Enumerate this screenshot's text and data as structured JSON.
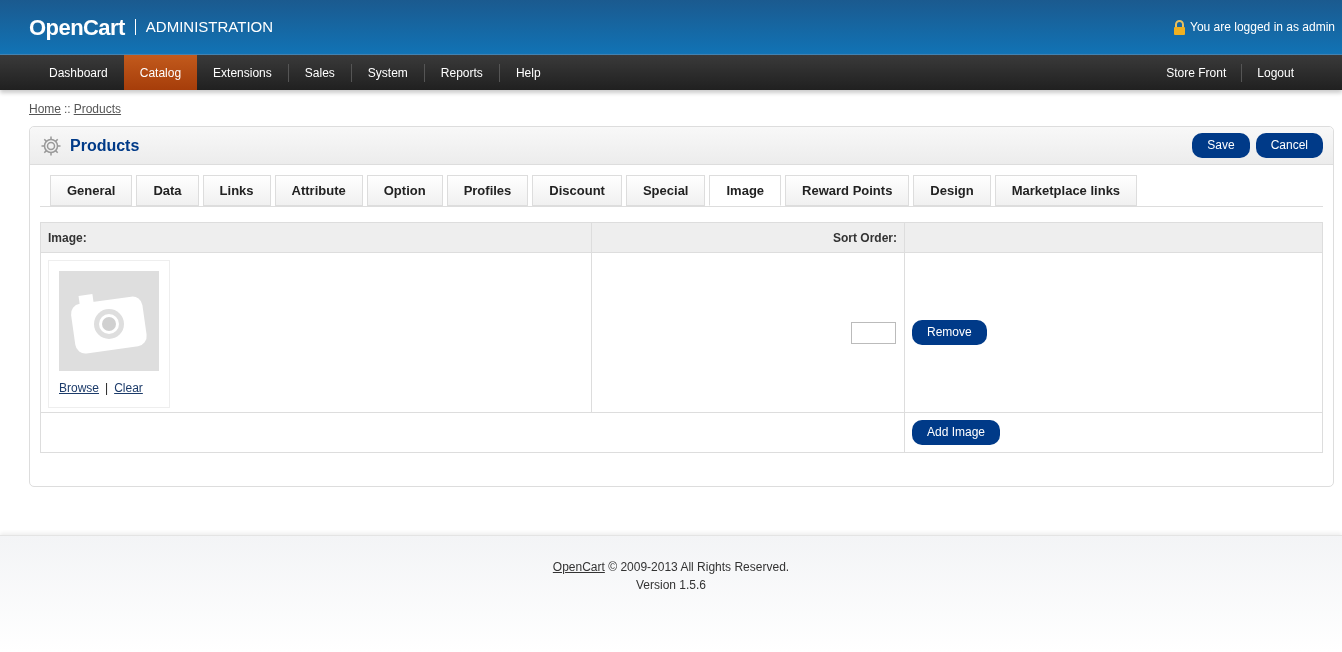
{
  "header": {
    "logo": "OpenCart",
    "subtitle": "ADMINISTRATION",
    "login_text": "You are logged in as admin"
  },
  "nav": {
    "left": [
      {
        "label": "Dashboard",
        "selected": false
      },
      {
        "label": "Catalog",
        "selected": true
      },
      {
        "label": "Extensions",
        "selected": false
      },
      {
        "label": "Sales",
        "selected": false
      },
      {
        "label": "System",
        "selected": false
      },
      {
        "label": "Reports",
        "selected": false
      },
      {
        "label": "Help",
        "selected": false
      }
    ],
    "right": [
      "Store Front",
      "Logout"
    ]
  },
  "breadcrumb": {
    "items": [
      "Home",
      "Products"
    ],
    "separator": "::"
  },
  "panel": {
    "title": "Products",
    "buttons": [
      "Save",
      "Cancel"
    ],
    "tabs": [
      {
        "label": "General",
        "selected": false
      },
      {
        "label": "Data",
        "selected": false
      },
      {
        "label": "Links",
        "selected": false
      },
      {
        "label": "Attribute",
        "selected": false
      },
      {
        "label": "Option",
        "selected": false
      },
      {
        "label": "Profiles",
        "selected": false
      },
      {
        "label": "Discount",
        "selected": false
      },
      {
        "label": "Special",
        "selected": false
      },
      {
        "label": "Image",
        "selected": true
      },
      {
        "label": "Reward Points",
        "selected": false
      },
      {
        "label": "Design",
        "selected": false
      },
      {
        "label": "Marketplace links",
        "selected": false
      }
    ],
    "table": {
      "columns": [
        "Image:",
        "Sort Order:"
      ],
      "rows": [
        {
          "links": [
            "Browse",
            "Clear"
          ],
          "link_separator": "|",
          "button": "Remove"
        }
      ],
      "add_button": "Add Image"
    }
  },
  "footer": {
    "link": "OpenCart",
    "text": "© 2009-2013 All Rights Reserved.",
    "version": "Version 1.5.6"
  }
}
